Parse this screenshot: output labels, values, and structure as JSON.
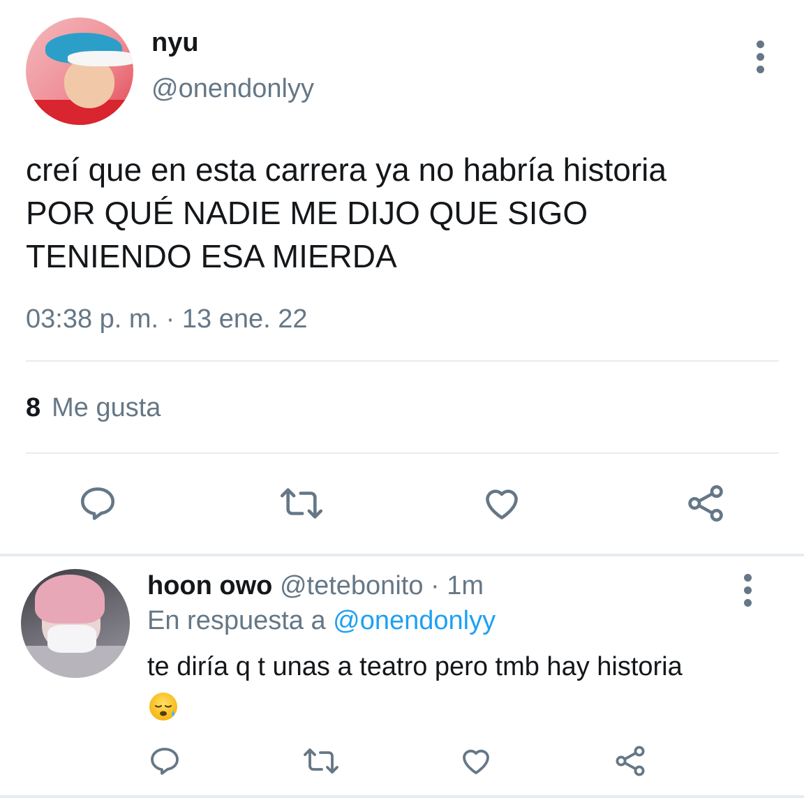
{
  "tweet": {
    "author_name": "nyu",
    "author_handle": "@onendonlyy",
    "text_lines": [
      "creí que en esta carrera ya no habría historia",
      "POR QUÉ NADIE ME DIJO QUE SIGO",
      "TENIENDO ESA MIERDA"
    ],
    "timestamp": "03:38 p. m. · 13 ene. 22",
    "likes_count": "8",
    "likes_label": "Me gusta"
  },
  "reply": {
    "author_name": "hoon owo",
    "author_handle": "@tetebonito",
    "time": " · 1m",
    "replying_to_label": "En respuesta a ",
    "replying_to_handle": "@onendonlyy",
    "text": "te diría q t unas a teatro pero tmb hay historia"
  },
  "icons": {
    "menu": "more-vertical-icon",
    "reply": "comment-icon",
    "retweet": "retweet-icon",
    "like": "heart-icon",
    "share": "share-icon",
    "emoji": "sad-sweat-face-emoji"
  },
  "colors": {
    "text_primary": "#14171a",
    "text_secondary": "#657786",
    "accent": "#1da1f2",
    "divider": "#e6ecf0"
  }
}
